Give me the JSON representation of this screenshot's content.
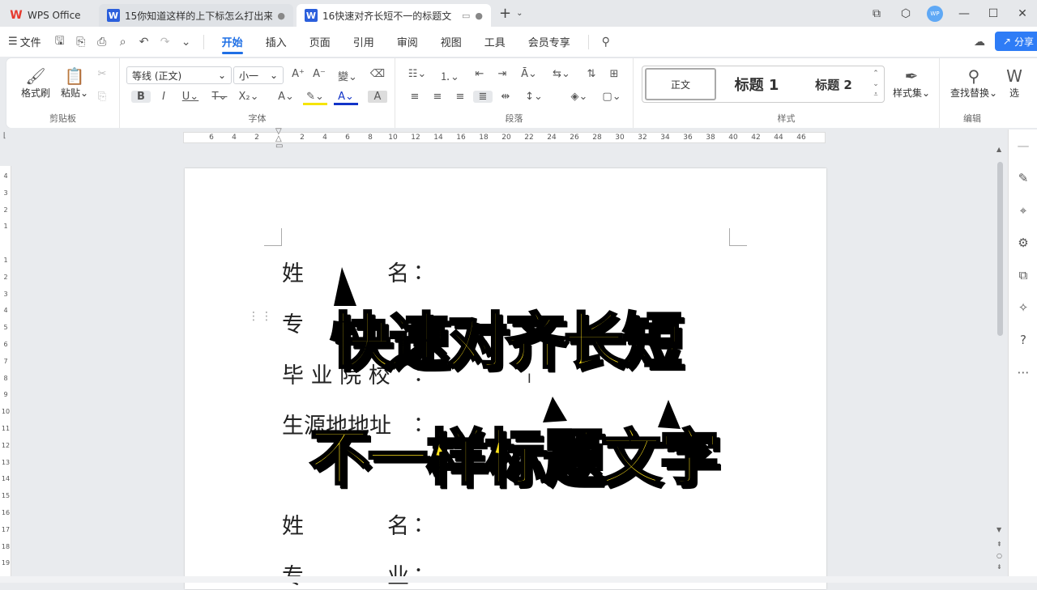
{
  "tabs": {
    "home": "WPS Office",
    "doc1": "15你知道这样的上下标怎么打出来",
    "doc2": "16快速对齐长短不一的标题文"
  },
  "window": {
    "avatar": "WP",
    "minimize": "—",
    "maximize": "☐",
    "close": "✕"
  },
  "menu": {
    "file": "文件",
    "tabs": [
      "开始",
      "插入",
      "页面",
      "引用",
      "审阅",
      "视图",
      "工具",
      "会员专享"
    ],
    "share": "分享"
  },
  "ribbon": {
    "clipboard": {
      "format_painter": "格式刷",
      "paste": "粘贴",
      "group": "剪贴板"
    },
    "font": {
      "font_name": "等线 (正文)",
      "font_size": "小一",
      "group": "字体"
    },
    "paragraph": {
      "group": "段落"
    },
    "styles": {
      "normal": "正文",
      "h1": "标题 1",
      "h2": "标题 2",
      "style_set": "样式集",
      "group": "样式"
    },
    "editing": {
      "find_replace": "查找替换",
      "select": "选",
      "group": "编辑"
    }
  },
  "ruler": {
    "labels": [
      "6",
      "4",
      "2",
      "",
      "2",
      "4",
      "6",
      "8",
      "10",
      "12",
      "14",
      "16",
      "18",
      "20",
      "22",
      "24",
      "26",
      "28",
      "30",
      "32",
      "34",
      "36",
      "38",
      "40",
      "42",
      "44",
      "46"
    ]
  },
  "vruler": {
    "labels": [
      "4",
      "3",
      "2",
      "1",
      "",
      "1",
      "2",
      "3",
      "4",
      "5",
      "6",
      "7",
      "8",
      "9",
      "10",
      "11",
      "12",
      "13",
      "14",
      "15",
      "16",
      "17",
      "18",
      "19"
    ]
  },
  "document": {
    "lines": [
      {
        "a": "姓",
        "b": "名",
        "colon": "："
      },
      {
        "a": "专",
        "b": "",
        "colon": ""
      },
      {
        "a": "毕 业 院 校",
        "b": "",
        "colon": "："
      },
      {
        "a": "生源地地址",
        "b": "",
        "colon": "："
      },
      {
        "a": "姓",
        "b": "名",
        "colon": "："
      },
      {
        "a": "专",
        "b": "业",
        "colon": "："
      }
    ],
    "overlay1": "快速对齐长短",
    "overlay2": "不一样标题文字"
  },
  "colors": {
    "accent": "#1f6fe5",
    "overlay_text": "#ffe31a"
  }
}
